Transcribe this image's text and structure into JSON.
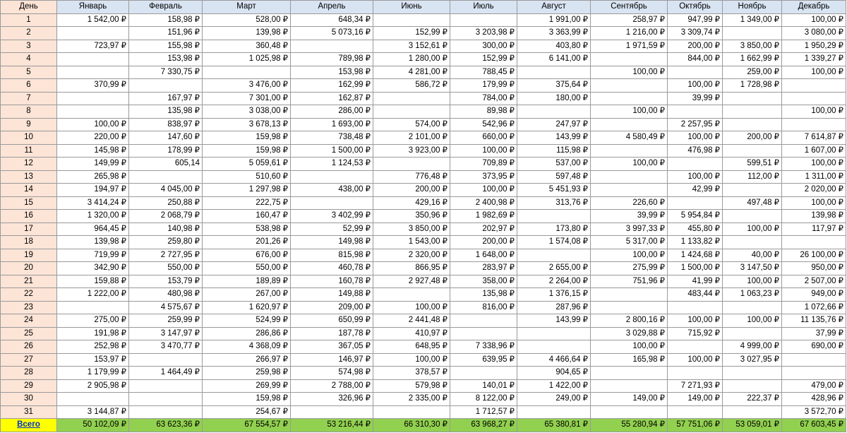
{
  "sheet": {
    "day_header": "День",
    "months": [
      "Январь",
      "Февраль",
      "Март",
      "Апрель",
      "Июнь",
      "Июль",
      "Август",
      "Сентябрь",
      "Октябрь",
      "Ноябрь",
      "Декабрь"
    ],
    "rows": [
      {
        "day": "1",
        "values": [
          "1 542,00 ₽",
          "158,98 ₽",
          "528,00 ₽",
          "648,34 ₽",
          "",
          "",
          "1 991,00 ₽",
          "258,97 ₽",
          "947,99 ₽",
          "1 349,00 ₽",
          "100,00 ₽"
        ]
      },
      {
        "day": "2",
        "values": [
          "",
          "151,96 ₽",
          "139,98 ₽",
          "5 073,16 ₽",
          "152,99 ₽",
          "3 203,98 ₽",
          "3 363,99 ₽",
          "1 216,00 ₽",
          "3 309,74 ₽",
          "",
          "3 080,00 ₽"
        ]
      },
      {
        "day": "3",
        "values": [
          "723,97 ₽",
          "155,98 ₽",
          "360,48 ₽",
          "",
          "3 152,61 ₽",
          "300,00 ₽",
          "403,80 ₽",
          "1 971,59 ₽",
          "200,00 ₽",
          "3 850,00 ₽",
          "1 950,29 ₽"
        ]
      },
      {
        "day": "4",
        "values": [
          "",
          "153,98 ₽",
          "1 025,98 ₽",
          "789,98 ₽",
          "1 280,00 ₽",
          "152,99 ₽",
          "6 141,00 ₽",
          "",
          "844,00 ₽",
          "1 662,99 ₽",
          "1 339,27 ₽"
        ]
      },
      {
        "day": "5",
        "values": [
          "",
          "7 330,75 ₽",
          "",
          "153,98 ₽",
          "4 281,00 ₽",
          "788,45 ₽",
          "",
          "100,00 ₽",
          "",
          "259,00 ₽",
          "100,00 ₽"
        ]
      },
      {
        "day": "6",
        "values": [
          "370,99 ₽",
          "",
          "3 476,00 ₽",
          "162,99 ₽",
          "586,72 ₽",
          "179,99 ₽",
          "375,64 ₽",
          "",
          "100,00 ₽",
          "1 728,98 ₽",
          ""
        ]
      },
      {
        "day": "7",
        "values": [
          "",
          "167,97 ₽",
          "7 301,00 ₽",
          "162,87 ₽",
          "",
          "784,00 ₽",
          "180,00 ₽",
          "",
          "39,99 ₽",
          "",
          ""
        ]
      },
      {
        "day": "8",
        "values": [
          "",
          "135,98 ₽",
          "3 038,00 ₽",
          "286,00 ₽",
          "",
          "89,98 ₽",
          "",
          "100,00 ₽",
          "",
          "",
          "100,00 ₽"
        ]
      },
      {
        "day": "9",
        "values": [
          "100,00 ₽",
          "838,97 ₽",
          "3 678,13 ₽",
          "1 693,00 ₽",
          "574,00 ₽",
          "542,96 ₽",
          "247,97 ₽",
          "",
          "2 257,95 ₽",
          "",
          ""
        ]
      },
      {
        "day": "10",
        "values": [
          "220,00 ₽",
          "147,60 ₽",
          "159,98 ₽",
          "738,48 ₽",
          "2 101,00 ₽",
          "660,00 ₽",
          "143,99 ₽",
          "4 580,49 ₽",
          "100,00 ₽",
          "200,00 ₽",
          "7 614,87 ₽"
        ]
      },
      {
        "day": "11",
        "values": [
          "145,98 ₽",
          "178,99 ₽",
          "159,98 ₽",
          "1 500,00 ₽",
          "3 923,00 ₽",
          "100,00 ₽",
          "115,98 ₽",
          "",
          "476,98 ₽",
          "",
          "1 607,00 ₽"
        ]
      },
      {
        "day": "12",
        "values": [
          "149,99 ₽",
          "605,14",
          "5 059,61 ₽",
          "1 124,53 ₽",
          "",
          "709,89 ₽",
          "537,00 ₽",
          "100,00 ₽",
          "",
          "599,51 ₽",
          "100,00 ₽"
        ]
      },
      {
        "day": "13",
        "values": [
          "265,98 ₽",
          "",
          "510,60 ₽",
          "",
          "776,48 ₽",
          "373,95 ₽",
          "597,48 ₽",
          "",
          "100,00 ₽",
          "112,00 ₽",
          "1 311,00 ₽"
        ]
      },
      {
        "day": "14",
        "values": [
          "194,97 ₽",
          "4 045,00 ₽",
          "1 297,98 ₽",
          "438,00 ₽",
          "200,00 ₽",
          "100,00 ₽",
          "5 451,93 ₽",
          "",
          "42,99 ₽",
          "",
          "2 020,00 ₽"
        ]
      },
      {
        "day": "15",
        "values": [
          "3 414,24 ₽",
          "250,88 ₽",
          "222,75 ₽",
          "",
          "429,16 ₽",
          "2 400,98 ₽",
          "313,76 ₽",
          "226,60 ₽",
          "",
          "497,48 ₽",
          "100,00 ₽"
        ]
      },
      {
        "day": "16",
        "values": [
          "1 320,00 ₽",
          "2 068,79 ₽",
          "160,47 ₽",
          "3 402,99 ₽",
          "350,96 ₽",
          "1 982,69 ₽",
          "",
          "39,99 ₽",
          "5 954,84 ₽",
          "",
          "139,98 ₽"
        ]
      },
      {
        "day": "17",
        "values": [
          "964,45 ₽",
          "140,98 ₽",
          "538,98 ₽",
          "52,99 ₽",
          "3 850,00 ₽",
          "202,97 ₽",
          "173,80 ₽",
          "3 997,33 ₽",
          "455,80 ₽",
          "100,00 ₽",
          "117,97 ₽"
        ]
      },
      {
        "day": "18",
        "values": [
          "139,98 ₽",
          "259,80 ₽",
          "201,26 ₽",
          "149,98 ₽",
          "1 543,00 ₽",
          "200,00 ₽",
          "1 574,08 ₽",
          "5 317,00 ₽",
          "1 133,82 ₽",
          "",
          ""
        ]
      },
      {
        "day": "19",
        "values": [
          "719,99 ₽",
          "2 727,95 ₽",
          "676,00 ₽",
          "815,98 ₽",
          "2 320,00 ₽",
          "1 648,00 ₽",
          "",
          "100,00 ₽",
          "1 424,68 ₽",
          "40,00 ₽",
          "26 100,00 ₽"
        ]
      },
      {
        "day": "20",
        "values": [
          "342,90 ₽",
          "550,00 ₽",
          "550,00 ₽",
          "460,78 ₽",
          "866,95 ₽",
          "283,97 ₽",
          "2 655,00 ₽",
          "275,99 ₽",
          "1 500,00 ₽",
          "3 147,50 ₽",
          "950,00 ₽"
        ]
      },
      {
        "day": "21",
        "values": [
          "159,88 ₽",
          "153,79 ₽",
          "189,89 ₽",
          "160,78 ₽",
          "2 927,48 ₽",
          "358,00 ₽",
          "2 264,00 ₽",
          "751,96 ₽",
          "41,99 ₽",
          "100,00 ₽",
          "2 507,00 ₽"
        ]
      },
      {
        "day": "22",
        "values": [
          "1 222,00 ₽",
          "480,98 ₽",
          "267,00 ₽",
          "149,88 ₽",
          "",
          "135,98 ₽",
          "1 376,15 ₽",
          "",
          "483,44 ₽",
          "1 063,23 ₽",
          "949,00 ₽"
        ]
      },
      {
        "day": "23",
        "values": [
          "",
          "4 575,67 ₽",
          "1 620,97 ₽",
          "209,00 ₽",
          "100,00 ₽",
          "816,00 ₽",
          "287,96 ₽",
          "",
          "",
          "",
          "1 072,66 ₽"
        ]
      },
      {
        "day": "24",
        "values": [
          "275,00 ₽",
          "259,99 ₽",
          "524,99 ₽",
          "650,99 ₽",
          "2 441,48 ₽",
          "",
          "143,99 ₽",
          "2 800,16 ₽",
          "100,00 ₽",
          "100,00 ₽",
          "11 135,76 ₽"
        ]
      },
      {
        "day": "25",
        "values": [
          "191,98 ₽",
          "3 147,97 ₽",
          "286,86 ₽",
          "187,78 ₽",
          "410,97 ₽",
          "",
          "",
          "3 029,88 ₽",
          "715,92 ₽",
          "",
          "37,99 ₽"
        ]
      },
      {
        "day": "26",
        "values": [
          "252,98 ₽",
          "3 470,77 ₽",
          "4 368,09 ₽",
          "367,05 ₽",
          "648,95 ₽",
          "7 338,96 ₽",
          "",
          "100,00 ₽",
          "",
          "4 999,00 ₽",
          "690,00 ₽"
        ]
      },
      {
        "day": "27",
        "values": [
          "153,97 ₽",
          "",
          "266,97 ₽",
          "146,97 ₽",
          "100,00 ₽",
          "639,95 ₽",
          "4 466,64 ₽",
          "165,98 ₽",
          "100,00 ₽",
          "3 027,95 ₽",
          ""
        ]
      },
      {
        "day": "28",
        "values": [
          "1 179,99 ₽",
          "1 464,49 ₽",
          "259,98 ₽",
          "574,98 ₽",
          "378,57 ₽",
          "",
          "904,65 ₽",
          "",
          "",
          "",
          ""
        ]
      },
      {
        "day": "29",
        "values": [
          "2 905,98 ₽",
          "",
          "269,99 ₽",
          "2 788,00 ₽",
          "579,98 ₽",
          "140,01 ₽",
          "1 422,00 ₽",
          "",
          "7 271,93 ₽",
          "",
          "479,00 ₽"
        ]
      },
      {
        "day": "30",
        "values": [
          "",
          "",
          "159,98 ₽",
          "326,96 ₽",
          "2 335,00 ₽",
          "8 122,00 ₽",
          "249,00 ₽",
          "149,00 ₽",
          "149,00 ₽",
          "222,37 ₽",
          "428,96 ₽"
        ]
      },
      {
        "day": "31",
        "values": [
          "3 144,87 ₽",
          "",
          "254,67 ₽",
          "",
          "",
          "1 712,57 ₽",
          "",
          "",
          "",
          "",
          "3 572,70 ₽"
        ]
      }
    ],
    "total": {
      "label": "Всего",
      "values": [
        "50 102,09 ₽",
        "63 623,36 ₽",
        "67 554,57 ₽",
        "53 216,44 ₽",
        "66 310,30 ₽",
        "63 968,27 ₽",
        "65 380,81 ₽",
        "55 280,94 ₽",
        "57 751,06 ₽",
        "53 059,01 ₽",
        "67 603,45 ₽"
      ]
    },
    "colors": {
      "header_bg": "#d9e4f2",
      "day_bg": "#fce4d6",
      "total_bg": "#92d050",
      "total_label_bg": "#ffff00",
      "total_label_text": "#0033cc"
    }
  }
}
